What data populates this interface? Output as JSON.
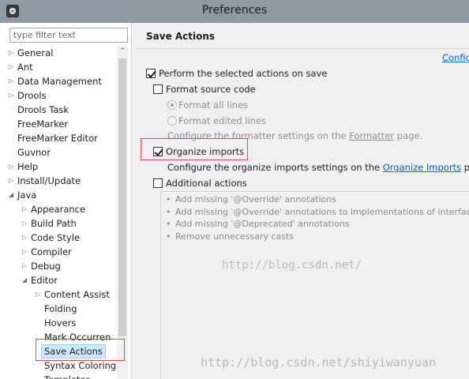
{
  "window": {
    "title": "Preferences"
  },
  "filter": {
    "placeholder": "type filter text"
  },
  "tree": [
    {
      "label": "General",
      "twisty": "▷"
    },
    {
      "label": "Ant",
      "twisty": "▷"
    },
    {
      "label": "Data Management",
      "twisty": "▷"
    },
    {
      "label": "Drools",
      "twisty": "▷"
    },
    {
      "label": "Drools Task",
      "twisty": ""
    },
    {
      "label": "FreeMarker",
      "twisty": ""
    },
    {
      "label": "FreeMarker Editor",
      "twisty": ""
    },
    {
      "label": "Guvnor",
      "twisty": ""
    },
    {
      "label": "Help",
      "twisty": "▷"
    },
    {
      "label": "Install/Update",
      "twisty": "▷"
    },
    {
      "label": "Java",
      "twisty": "◢"
    },
    {
      "label": "Appearance",
      "twisty": "▷"
    },
    {
      "label": "Build Path",
      "twisty": "▷"
    },
    {
      "label": "Code Style",
      "twisty": "▷"
    },
    {
      "label": "Compiler",
      "twisty": "▷"
    },
    {
      "label": "Debug",
      "twisty": "▷"
    },
    {
      "label": "Editor",
      "twisty": "◢"
    },
    {
      "label": "Content Assist",
      "twisty": "▷"
    },
    {
      "label": "Folding",
      "twisty": ""
    },
    {
      "label": "Hovers",
      "twisty": ""
    },
    {
      "label": "Mark Occurren",
      "twisty": ""
    },
    {
      "label": "Save Actions",
      "twisty": "",
      "selected": true
    },
    {
      "label": "Syntax Coloring",
      "twisty": ""
    },
    {
      "label": "Templates",
      "twisty": ""
    }
  ],
  "page": {
    "title": "Save Actions",
    "configure_link": "Configu",
    "perform_label": "Perform the selected actions on save",
    "format_label": "Format source code",
    "format_all": "Format all lines",
    "format_edited": "Format edited lines",
    "formatter_hint_pre": "Configure the formatter settings on the ",
    "formatter_link": "Formatter",
    "formatter_hint_post": " page.",
    "organize_label": "Organize imports",
    "organize_hint_pre": "Configure the organize imports settings on the ",
    "organize_link": "Organize Imports",
    "organize_hint_post": " page.",
    "additional_label": "Additional actions",
    "actions": [
      "Add missing '@Override' annotations",
      "Add missing '@Override' annotations to implementations of interface m",
      "Add missing '@Deprecated' annotations",
      "Remove unnecessary casts"
    ]
  },
  "checks": {
    "perform": true,
    "format": false,
    "format_all": true,
    "format_edited": false,
    "organize": true,
    "additional": false
  },
  "watermarks": {
    "center": "http://blog.csdn.net/",
    "bottom": "http://blog.csdn.net/shiyiwanyuan"
  },
  "colors": {
    "titlebar": "#8e9aa3",
    "highlight_box": "#e24b4b",
    "link": "#0066cc",
    "selection": "#cde8ff"
  }
}
